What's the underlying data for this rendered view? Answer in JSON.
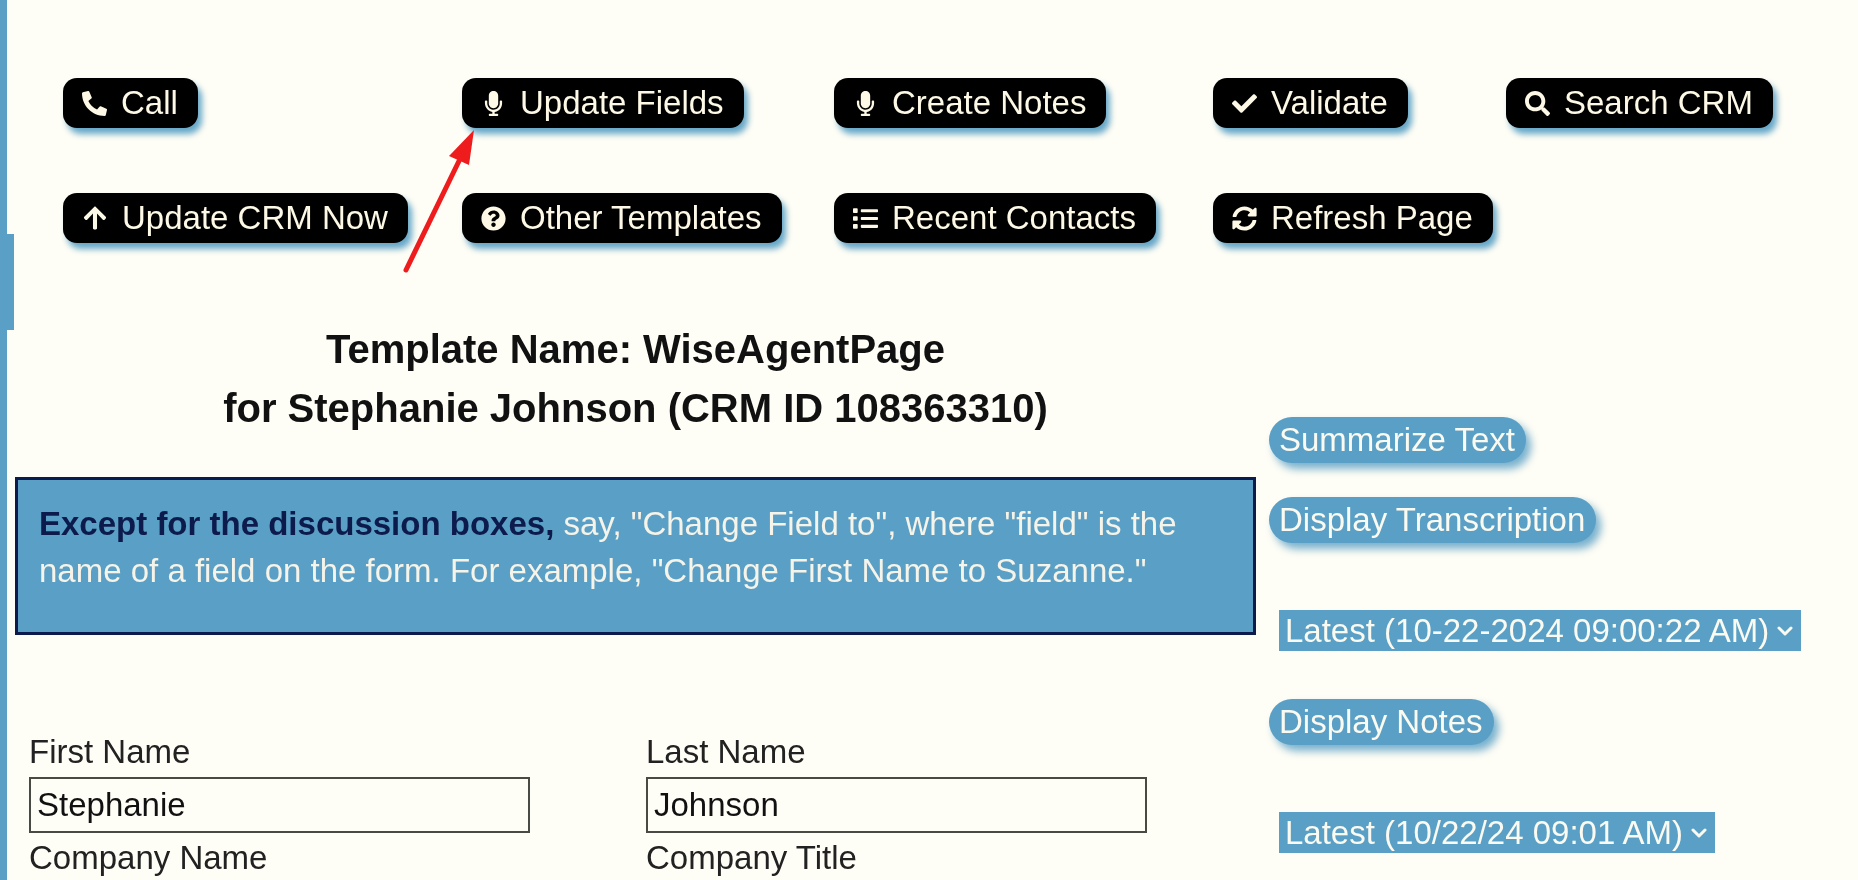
{
  "toolbar": [
    {
      "label": "Call"
    },
    {
      "label": "Update Fields"
    },
    {
      "label": "Create Notes"
    },
    {
      "label": "Validate"
    },
    {
      "label": "Search CRM"
    },
    {
      "label": "Update CRM Now"
    },
    {
      "label": "Other Templates"
    },
    {
      "label": "Recent Contacts"
    },
    {
      "label": "Refresh Page"
    }
  ],
  "template_heading": {
    "line_1": "Template Name: WiseAgentPage",
    "line_2": "for Stephanie Johnson (CRM ID 108363310)"
  },
  "instructions": {
    "text": "**Except for the discussion boxes,** say, \"Change Field to\", where \"field\" is the name of a field on the form. For example, \"Change First Name to Suzanne.\""
  },
  "form": {
    "fields": [
      {
        "label": "First Name",
        "value": "Stephanie"
      },
      {
        "label": "Last Name",
        "value": "Johnson"
      },
      {
        "label": "Company Name"
      },
      {
        "label": "Company Title"
      }
    ]
  },
  "side_panel": [
    {
      "kind": "button",
      "label": "Summarize Text"
    },
    {
      "kind": "button",
      "label": "Display Transcription"
    },
    {
      "kind": "select",
      "value": "Latest (10-22-2024 09:00:22 AM)"
    },
    {
      "kind": "button",
      "label": "Display Notes"
    },
    {
      "kind": "select",
      "value": "Latest (10/22/24 09:01 AM)"
    }
  ]
}
